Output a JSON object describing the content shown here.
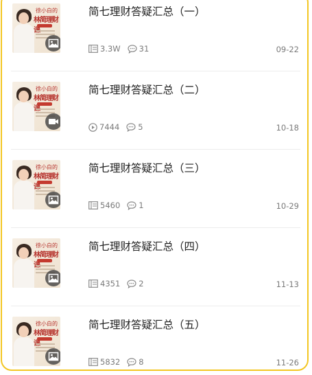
{
  "items": [
    {
      "title": "简七理财答疑汇总（一）",
      "stat_icon": "article-icon",
      "stat": "3.3W",
      "comments": "31",
      "date": "09-22",
      "badge": "image-icon"
    },
    {
      "title": "简七理财答疑汇总（二）",
      "stat_icon": "play-icon",
      "stat": "7444",
      "comments": "5",
      "date": "10-18",
      "badge": "video-icon"
    },
    {
      "title": "简七理财答疑汇总（三）",
      "stat_icon": "article-icon",
      "stat": "5460",
      "comments": "1",
      "date": "10-29",
      "badge": "image-icon"
    },
    {
      "title": "简七理财答疑汇总（四）",
      "stat_icon": "article-icon",
      "stat": "4351",
      "comments": "2",
      "date": "11-13",
      "badge": "image-icon"
    },
    {
      "title": "简七理财答疑汇总（五）",
      "stat_icon": "article-icon",
      "stat": "5832",
      "comments": "8",
      "date": "11-26",
      "badge": "image-icon"
    }
  ],
  "thumbnail": {
    "script_text": "徐小白的",
    "brand_text": "林简理财课"
  },
  "colors": {
    "border": "#f3c623",
    "title": "#222222",
    "meta": "#7a7a7a"
  }
}
